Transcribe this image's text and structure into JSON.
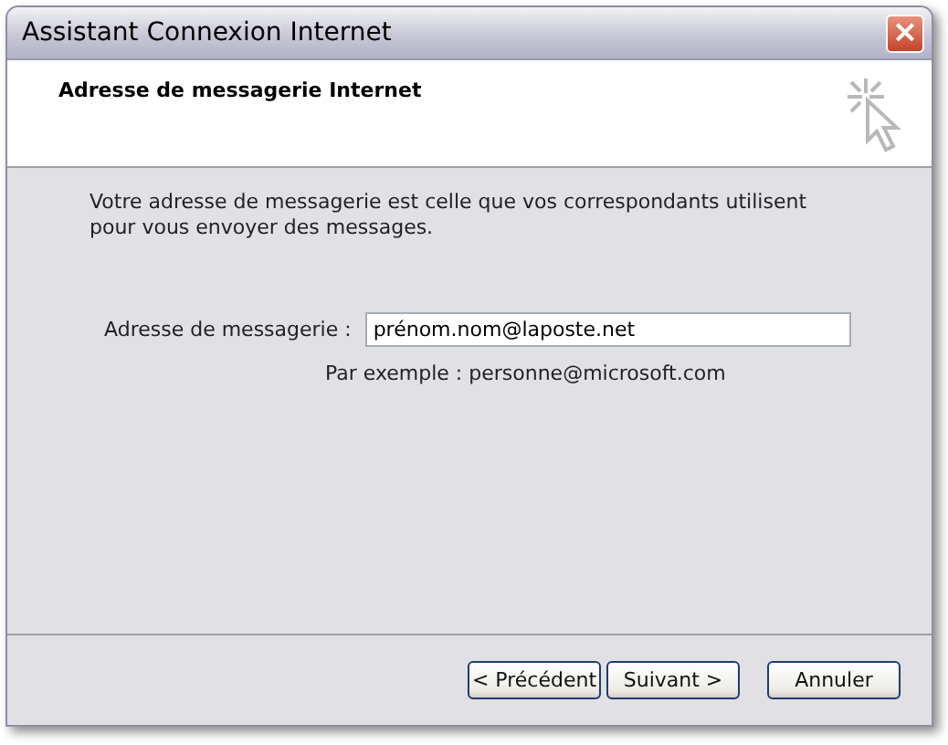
{
  "window": {
    "title": "Assistant Connexion Internet",
    "close_label": "×"
  },
  "header": {
    "title": "Adresse de messagerie Internet"
  },
  "description": "Votre adresse de messagerie est celle que vos correspondants utilisent pour vous envoyer des messages.",
  "email_field": {
    "label": "Adresse de messagerie :",
    "value": "prénom.nom@laposte.net"
  },
  "example": "Par exemple : personne@microsoft.com",
  "buttons": [
    {
      "label": "< Précédent"
    },
    {
      "label": "Suivant >"
    },
    {
      "label": "Annuler"
    }
  ]
}
